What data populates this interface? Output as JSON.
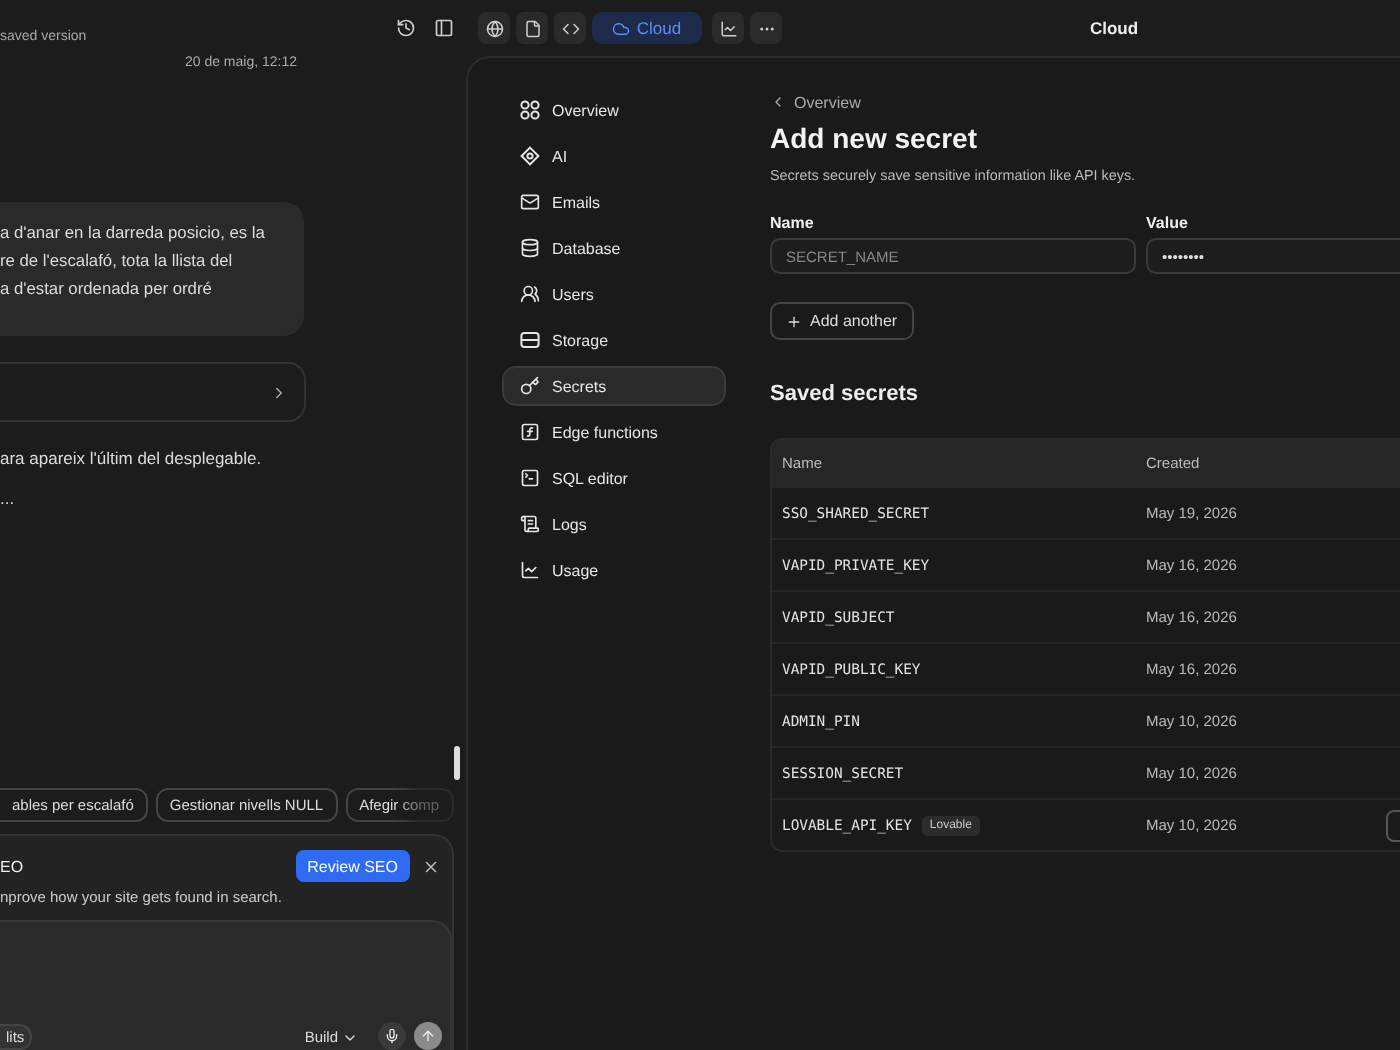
{
  "top_bar": {
    "version_label": "saved version",
    "cloud_button": {
      "label": "Cloud",
      "selected": true
    },
    "title": "Cloud"
  },
  "chat": {
    "date": "20 de maig, 12:12",
    "message_lines": [
      "a d'anar en la darreda posicio, es la",
      "re de l'escalafó, tota la llista del",
      "a d'estar ordenada per ordré"
    ],
    "reply_lines": [
      "ara apareix l'últim del desplegable.",
      "..."
    ],
    "suggestions": [
      {
        "label": "ables per escalafó"
      },
      {
        "label": "Gestionar nivells NULL"
      },
      {
        "label": "Afegir comp"
      }
    ],
    "seo_banner": {
      "title": "EO",
      "action": "Review SEO",
      "text": "nprove how your site gets found in search."
    },
    "composer": {
      "chip": "lits",
      "mode": "Build"
    }
  },
  "cloud": {
    "nav": [
      {
        "label": "Overview",
        "selected": false
      },
      {
        "label": "AI",
        "selected": false
      },
      {
        "label": "Emails",
        "selected": false
      },
      {
        "label": "Database",
        "selected": false
      },
      {
        "label": "Users",
        "selected": false
      },
      {
        "label": "Storage",
        "selected": false
      },
      {
        "label": "Secrets",
        "selected": true
      },
      {
        "label": "Edge functions",
        "selected": false
      },
      {
        "label": "SQL editor",
        "selected": false
      },
      {
        "label": "Logs",
        "selected": false
      },
      {
        "label": "Usage",
        "selected": false
      }
    ],
    "breadcrumb": "Overview",
    "title": "Add new secret",
    "description": "Secrets securely save sensitive information like API keys.",
    "form": {
      "name_label": "Name",
      "name_placeholder": "SECRET_NAME",
      "value_label": "Value",
      "value": "••••••••",
      "add_button": "Add another"
    },
    "saved_title": "Saved secrets",
    "table": {
      "columns": [
        "Name",
        "Created"
      ],
      "rows": [
        {
          "name": "SSO_SHARED_SECRET",
          "created": "May 19, 2026"
        },
        {
          "name": "VAPID_PRIVATE_KEY",
          "created": "May 16, 2026"
        },
        {
          "name": "VAPID_SUBJECT",
          "created": "May 16, 2026"
        },
        {
          "name": "VAPID_PUBLIC_KEY",
          "created": "May 16, 2026"
        },
        {
          "name": "ADMIN_PIN",
          "created": "May 10, 2026"
        },
        {
          "name": "SESSION_SECRET",
          "created": "May 10, 2026"
        },
        {
          "name": "LOVABLE_API_KEY",
          "badge": "Lovable",
          "created": "May 10, 2026"
        }
      ]
    }
  }
}
